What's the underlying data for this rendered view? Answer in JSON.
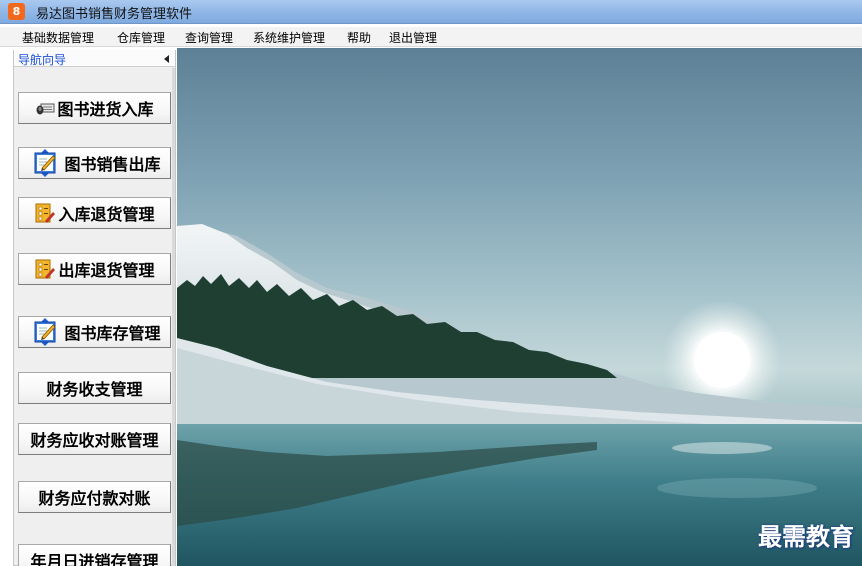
{
  "window": {
    "title": "易达图书销售财务管理软件",
    "icon_glyph": "8"
  },
  "menu": {
    "items": [
      "基础数据管理",
      "仓库管理",
      "查询管理",
      "系统维护管理",
      "帮助",
      "退出管理"
    ]
  },
  "sidebar": {
    "title": "导航向导",
    "buttons": [
      {
        "label": "图书进货入库",
        "icon": "keyboard-mouse-icon"
      },
      {
        "label": "图书销售出库",
        "icon": "book-edit-icon"
      },
      {
        "label": "入库退货管理",
        "icon": "folder-list-icon"
      },
      {
        "label": "出库退货管理",
        "icon": "folder-list-icon"
      },
      {
        "label": "图书库存管理",
        "icon": "book-edit-icon"
      },
      {
        "label": "财务收支管理",
        "icon": ""
      },
      {
        "label": "财务应收对账管理",
        "icon": ""
      },
      {
        "label": "财务应付款对账",
        "icon": ""
      },
      {
        "label": "年月日进销存管理",
        "icon": ""
      }
    ]
  },
  "desktop": {
    "watermark": "最需教育"
  },
  "colors": {
    "title_bar": "#8fb6e6",
    "nav_title": "#1a4fd6",
    "icon_orange": "#f2691e"
  }
}
